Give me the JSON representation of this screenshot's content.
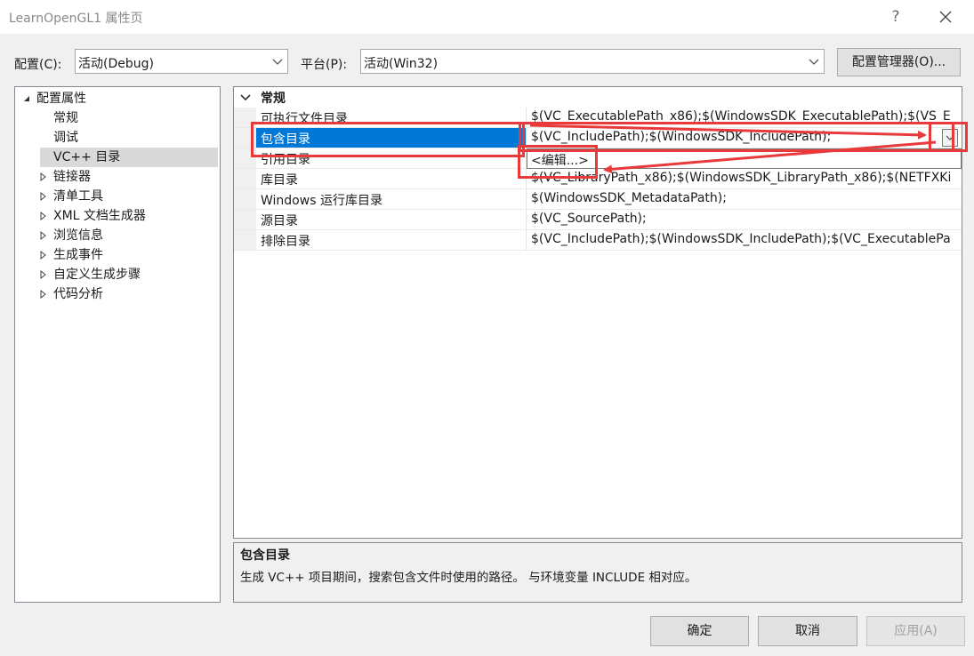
{
  "window": {
    "title": "LearnOpenGL1 属性页",
    "help_glyph": "?",
    "close_glyph": "✕"
  },
  "config_row": {
    "config_label": "配置(C):",
    "config_value": "活动(Debug)",
    "platform_label": "平台(P):",
    "platform_value": "活动(Win32)",
    "manager_button": "配置管理器(O)..."
  },
  "tree": {
    "root": "配置属性",
    "children": [
      "常规",
      "调试",
      "VC++ 目录"
    ],
    "collapsed": [
      "链接器",
      "清单工具",
      "XML 文档生成器",
      "浏览信息",
      "生成事件",
      "自定义生成步骤",
      "代码分析"
    ],
    "selected": "VC++ 目录"
  },
  "grid": {
    "category": "常规",
    "rows": [
      {
        "name": "可执行文件目录",
        "value": "$(VC_ExecutablePath_x86);$(WindowsSDK_ExecutablePath);$(VS_E"
      },
      {
        "name": "包含目录",
        "value": "$(VC_IncludePath);$(WindowsSDK_IncludePath);"
      },
      {
        "name": "引用目录",
        "value": ""
      },
      {
        "name": "库目录",
        "value": "$(VC_LibraryPath_x86);$(WindowsSDK_LibraryPath_x86);$(NETFXKi"
      },
      {
        "name": "Windows 运行库目录",
        "value": "$(WindowsSDK_MetadataPath);"
      },
      {
        "name": "源目录",
        "value": "$(VC_SourcePath);"
      },
      {
        "name": "排除目录",
        "value": "$(VC_IncludePath);$(WindowsSDK_IncludePath);$(VC_ExecutablePa"
      }
    ],
    "dropdown_option": "<编辑...>"
  },
  "description": {
    "title": "包含目录",
    "text": "生成 VC++ 项目期间，搜索包含文件时使用的路径。 与环境变量 INCLUDE 相对应。"
  },
  "buttons": {
    "ok": "确定",
    "cancel": "取消",
    "apply": "应用(A)"
  },
  "colors": {
    "selection": "#0078d7",
    "annotation": "#e8393b",
    "disabled_text": "#a0a0a0"
  }
}
